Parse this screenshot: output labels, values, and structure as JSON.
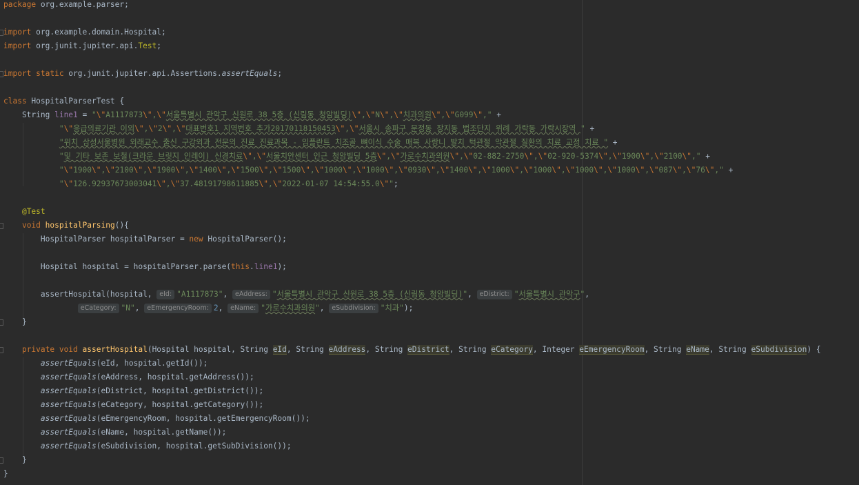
{
  "editor": {
    "lines": [
      [
        {
          "c": "kw",
          "t": "package"
        },
        {
          "t": " org.example.parser;"
        }
      ],
      [],
      [
        {
          "c": "kw",
          "t": "import"
        },
        {
          "t": " org.example.domain.Hospital;"
        }
      ],
      [
        {
          "c": "kw",
          "t": "import"
        },
        {
          "t": " org.junit.jupiter.api."
        },
        {
          "c": "ann",
          "t": "Test"
        },
        {
          "t": ";"
        }
      ],
      [],
      [
        {
          "c": "kw",
          "t": "import static"
        },
        {
          "t": " org.junit.jupiter.api.Assertions."
        },
        {
          "c": "ital",
          "t": "assertEquals"
        },
        {
          "t": ";"
        }
      ],
      [],
      [
        {
          "c": "kw",
          "t": "class"
        },
        {
          "t": " HospitalParserTest {"
        }
      ],
      [
        {
          "t": "    String "
        },
        {
          "c": "fld",
          "t": "line1"
        },
        {
          "t": " = "
        },
        {
          "c": "str",
          "t": "\""
        },
        {
          "c": "esc",
          "t": "\\\""
        },
        {
          "c": "str",
          "t": "A1117873"
        },
        {
          "c": "esc",
          "t": "\\\""
        },
        {
          "c": "str",
          "t": ","
        },
        {
          "c": "esc",
          "t": "\\\""
        },
        {
          "c": "str squig",
          "t": "서울특별시 관악구 신원로 38 5층 (신림동 청암빌딩)"
        },
        {
          "c": "esc",
          "t": "\\\""
        },
        {
          "c": "str",
          "t": ","
        },
        {
          "c": "esc",
          "t": "\\\""
        },
        {
          "c": "str",
          "t": "N"
        },
        {
          "c": "esc",
          "t": "\\\""
        },
        {
          "c": "str",
          "t": ","
        },
        {
          "c": "esc",
          "t": "\\\""
        },
        {
          "c": "str squig",
          "t": "치과의원"
        },
        {
          "c": "esc",
          "t": "\\\""
        },
        {
          "c": "str",
          "t": ","
        },
        {
          "c": "esc",
          "t": "\\\""
        },
        {
          "c": "str",
          "t": "G099"
        },
        {
          "c": "esc",
          "t": "\\\""
        },
        {
          "c": "str",
          "t": ",\""
        },
        {
          "t": " +"
        }
      ],
      [
        {
          "t": "            "
        },
        {
          "c": "str",
          "t": "\""
        },
        {
          "c": "esc",
          "t": "\\\""
        },
        {
          "c": "str squig",
          "t": "응급의료기관 이외"
        },
        {
          "c": "esc",
          "t": "\\\""
        },
        {
          "c": "str",
          "t": ","
        },
        {
          "c": "esc",
          "t": "\\\""
        },
        {
          "c": "str",
          "t": "2"
        },
        {
          "c": "esc",
          "t": "\\\""
        },
        {
          "c": "str",
          "t": ","
        },
        {
          "c": "esc",
          "t": "\\\""
        },
        {
          "c": "str squig",
          "t": "대표번호1 지역번호 추가20170118150453"
        },
        {
          "c": "esc",
          "t": "\\\""
        },
        {
          "c": "str",
          "t": ","
        },
        {
          "c": "esc",
          "t": "\\\""
        },
        {
          "c": "str squig",
          "t": "서울시 송파구 문정동 장지동 법조단지 위례 가락동 가락시장역 "
        },
        {
          "c": "str",
          "t": "\""
        },
        {
          "t": " +"
        }
      ],
      [
        {
          "t": "            "
        },
        {
          "c": "str squig",
          "t": "\"위치 삼성서울병원 외래교수 출신 구강외과 전문의 진료 진료과목 - 임플란트 치조골 뼈이식 수술 매복 사랑니 발치 턱관절 악관절 질환의 치료 교정 치료 \""
        },
        {
          "t": " +"
        }
      ],
      [
        {
          "t": "            "
        },
        {
          "c": "str",
          "t": "\""
        },
        {
          "c": "str squig",
          "t": "및 기타 보존 보철(크라운 브릿지 인레이) 신경치료"
        },
        {
          "c": "esc",
          "t": "\\\""
        },
        {
          "c": "str",
          "t": ","
        },
        {
          "c": "esc",
          "t": "\\\""
        },
        {
          "c": "str squig",
          "t": "서울치안센터 인근 청암빌딩 5층"
        },
        {
          "c": "esc",
          "t": "\\\""
        },
        {
          "c": "str",
          "t": ","
        },
        {
          "c": "esc",
          "t": "\\\""
        },
        {
          "c": "str squig",
          "t": "가로수치과의원"
        },
        {
          "c": "esc",
          "t": "\\\""
        },
        {
          "c": "str",
          "t": ","
        },
        {
          "c": "esc",
          "t": "\\\""
        },
        {
          "c": "str",
          "t": "02-882-2750"
        },
        {
          "c": "esc",
          "t": "\\\""
        },
        {
          "c": "str",
          "t": ","
        },
        {
          "c": "esc",
          "t": "\\\""
        },
        {
          "c": "str",
          "t": "02-920-5374"
        },
        {
          "c": "esc",
          "t": "\\\""
        },
        {
          "c": "str",
          "t": ","
        },
        {
          "c": "esc",
          "t": "\\\""
        },
        {
          "c": "str",
          "t": "1900"
        },
        {
          "c": "esc",
          "t": "\\\""
        },
        {
          "c": "str",
          "t": ","
        },
        {
          "c": "esc",
          "t": "\\\""
        },
        {
          "c": "str",
          "t": "2100"
        },
        {
          "c": "esc",
          "t": "\\\""
        },
        {
          "c": "str",
          "t": ",\""
        },
        {
          "t": " +"
        }
      ],
      [
        {
          "t": "            "
        },
        {
          "c": "str",
          "t": "\""
        },
        {
          "c": "esc",
          "t": "\\\""
        },
        {
          "c": "str",
          "t": "1900"
        },
        {
          "c": "esc",
          "t": "\\\""
        },
        {
          "c": "str",
          "t": ","
        },
        {
          "c": "esc",
          "t": "\\\""
        },
        {
          "c": "str",
          "t": "2100"
        },
        {
          "c": "esc",
          "t": "\\\""
        },
        {
          "c": "str",
          "t": ","
        },
        {
          "c": "esc",
          "t": "\\\""
        },
        {
          "c": "str",
          "t": "1900"
        },
        {
          "c": "esc",
          "t": "\\\""
        },
        {
          "c": "str",
          "t": ","
        },
        {
          "c": "esc",
          "t": "\\\""
        },
        {
          "c": "str",
          "t": "1400"
        },
        {
          "c": "esc",
          "t": "\\\""
        },
        {
          "c": "str",
          "t": ","
        },
        {
          "c": "esc",
          "t": "\\\""
        },
        {
          "c": "str",
          "t": "1500"
        },
        {
          "c": "esc",
          "t": "\\\""
        },
        {
          "c": "str",
          "t": ","
        },
        {
          "c": "esc",
          "t": "\\\""
        },
        {
          "c": "str",
          "t": "1500"
        },
        {
          "c": "esc",
          "t": "\\\""
        },
        {
          "c": "str",
          "t": ","
        },
        {
          "c": "esc",
          "t": "\\\""
        },
        {
          "c": "str",
          "t": "1000"
        },
        {
          "c": "esc",
          "t": "\\\""
        },
        {
          "c": "str",
          "t": ","
        },
        {
          "c": "esc",
          "t": "\\\""
        },
        {
          "c": "str",
          "t": "1000"
        },
        {
          "c": "esc",
          "t": "\\\""
        },
        {
          "c": "str",
          "t": ","
        },
        {
          "c": "esc",
          "t": "\\\""
        },
        {
          "c": "str",
          "t": "0930"
        },
        {
          "c": "esc",
          "t": "\\\""
        },
        {
          "c": "str",
          "t": ","
        },
        {
          "c": "esc",
          "t": "\\\""
        },
        {
          "c": "str",
          "t": "1400"
        },
        {
          "c": "esc",
          "t": "\\\""
        },
        {
          "c": "str",
          "t": ","
        },
        {
          "c": "esc",
          "t": "\\\""
        },
        {
          "c": "str",
          "t": "1000"
        },
        {
          "c": "esc",
          "t": "\\\""
        },
        {
          "c": "str",
          "t": ","
        },
        {
          "c": "esc",
          "t": "\\\""
        },
        {
          "c": "str",
          "t": "1000"
        },
        {
          "c": "esc",
          "t": "\\\""
        },
        {
          "c": "str",
          "t": ","
        },
        {
          "c": "esc",
          "t": "\\\""
        },
        {
          "c": "str",
          "t": "1000"
        },
        {
          "c": "esc",
          "t": "\\\""
        },
        {
          "c": "str",
          "t": ","
        },
        {
          "c": "esc",
          "t": "\\\""
        },
        {
          "c": "str",
          "t": "1000"
        },
        {
          "c": "esc",
          "t": "\\\""
        },
        {
          "c": "str",
          "t": ","
        },
        {
          "c": "esc",
          "t": "\\\""
        },
        {
          "c": "str",
          "t": "087"
        },
        {
          "c": "esc",
          "t": "\\\""
        },
        {
          "c": "str",
          "t": ","
        },
        {
          "c": "esc",
          "t": "\\\""
        },
        {
          "c": "str",
          "t": "76"
        },
        {
          "c": "esc",
          "t": "\\\""
        },
        {
          "c": "str",
          "t": ",\""
        },
        {
          "t": " +"
        }
      ],
      [
        {
          "t": "            "
        },
        {
          "c": "str",
          "t": "\""
        },
        {
          "c": "esc",
          "t": "\\\""
        },
        {
          "c": "str",
          "t": "126.92937673003041"
        },
        {
          "c": "esc",
          "t": "\\\""
        },
        {
          "c": "str",
          "t": ","
        },
        {
          "c": "esc",
          "t": "\\\""
        },
        {
          "c": "str",
          "t": "37.48191798611885"
        },
        {
          "c": "esc",
          "t": "\\\""
        },
        {
          "c": "str",
          "t": ","
        },
        {
          "c": "esc",
          "t": "\\\""
        },
        {
          "c": "str",
          "t": "2022-01-07 14:54:55.0"
        },
        {
          "c": "esc",
          "t": "\\\""
        },
        {
          "c": "str",
          "t": "\""
        },
        {
          "t": ";"
        }
      ],
      [],
      [
        {
          "t": "    "
        },
        {
          "c": "ann",
          "t": "@Test"
        }
      ],
      [
        {
          "t": "    "
        },
        {
          "c": "kw",
          "t": "void"
        },
        {
          "t": " "
        },
        {
          "c": "fn",
          "t": "hospitalParsing"
        },
        {
          "t": "(){"
        }
      ],
      [
        {
          "t": "        HospitalParser hospitalParser = "
        },
        {
          "c": "kw",
          "t": "new"
        },
        {
          "t": " HospitalParser();"
        }
      ],
      [],
      [
        {
          "t": "        Hospital hospital = hospitalParser.parse("
        },
        {
          "c": "kw",
          "t": "this"
        },
        {
          "t": "."
        },
        {
          "c": "fld",
          "t": "line1"
        },
        {
          "t": ");"
        }
      ],
      [],
      [
        {
          "t": "        assertHospital(hospital, "
        },
        {
          "c": "hint",
          "t": "eId:"
        },
        {
          "c": "str",
          "t": "\"A1117873\""
        },
        {
          "t": ", "
        },
        {
          "c": "hint",
          "t": "eAddress:"
        },
        {
          "c": "str",
          "t": "\""
        },
        {
          "c": "str squig",
          "t": "서울특별시 관악구 신원로 38 5층 (신림동 청암빌딩)"
        },
        {
          "c": "str",
          "t": "\""
        },
        {
          "t": ", "
        },
        {
          "c": "hint",
          "t": "eDistrict:"
        },
        {
          "c": "str",
          "t": "\""
        },
        {
          "c": "str squig",
          "t": "서울특별시 관악구"
        },
        {
          "c": "str",
          "t": "\""
        },
        {
          "t": ","
        }
      ],
      [
        {
          "t": "                "
        },
        {
          "c": "hint",
          "t": "eCategory:"
        },
        {
          "c": "str",
          "t": "\"N\""
        },
        {
          "t": ", "
        },
        {
          "c": "hint",
          "t": "eEmergencyRoom:"
        },
        {
          "c": "num",
          "t": "2"
        },
        {
          "t": ", "
        },
        {
          "c": "hint",
          "t": "eName:"
        },
        {
          "c": "str",
          "t": "\""
        },
        {
          "c": "str squig",
          "t": "가로수치과의원"
        },
        {
          "c": "str",
          "t": "\""
        },
        {
          "t": ", "
        },
        {
          "c": "hint",
          "t": "eSubdivision:"
        },
        {
          "c": "str",
          "t": "\"치과\""
        },
        {
          "t": ");"
        }
      ],
      [
        {
          "t": "    }"
        }
      ],
      [],
      [
        {
          "t": "    "
        },
        {
          "c": "kw",
          "t": "private void"
        },
        {
          "t": " "
        },
        {
          "c": "fn",
          "t": "assertHospital"
        },
        {
          "t": "(Hospital hospital, String "
        },
        {
          "c": "hl",
          "t": "eId"
        },
        {
          "t": ", String "
        },
        {
          "c": "hl",
          "t": "eAddress"
        },
        {
          "t": ", String "
        },
        {
          "c": "hl",
          "t": "eDistrict"
        },
        {
          "t": ", String "
        },
        {
          "c": "hl",
          "t": "eCategory"
        },
        {
          "t": ", Integer "
        },
        {
          "c": "hl",
          "t": "eEmergencyRoom"
        },
        {
          "t": ", String "
        },
        {
          "c": "hl",
          "t": "eName"
        },
        {
          "t": ", String "
        },
        {
          "c": "hl",
          "t": "eSubdivision"
        },
        {
          "t": ") {"
        }
      ],
      [
        {
          "t": "        "
        },
        {
          "c": "ital",
          "t": "assertEquals"
        },
        {
          "t": "(eId, hospital.getId());"
        }
      ],
      [
        {
          "t": "        "
        },
        {
          "c": "ital",
          "t": "assertEquals"
        },
        {
          "t": "(eAddress, hospital.getAddress());"
        }
      ],
      [
        {
          "t": "        "
        },
        {
          "c": "ital",
          "t": "assertEquals"
        },
        {
          "t": "(eDistrict, hospital.getDistrict());"
        }
      ],
      [
        {
          "t": "        "
        },
        {
          "c": "ital",
          "t": "assertEquals"
        },
        {
          "t": "(eCategory, hospital.getCategory());"
        }
      ],
      [
        {
          "t": "        "
        },
        {
          "c": "ital",
          "t": "assertEquals"
        },
        {
          "t": "(eEmergencyRoom, hospital.getEmergencyRoom());"
        }
      ],
      [
        {
          "t": "        "
        },
        {
          "c": "ital",
          "t": "assertEquals"
        },
        {
          "t": "(eName, hospital.getName());"
        }
      ],
      [
        {
          "t": "        "
        },
        {
          "c": "ital",
          "t": "assertEquals"
        },
        {
          "t": "(eSubdivision, hospital.getSubDivision());"
        }
      ],
      [
        {
          "t": "    }"
        }
      ],
      [
        {
          "t": "}"
        }
      ]
    ]
  }
}
